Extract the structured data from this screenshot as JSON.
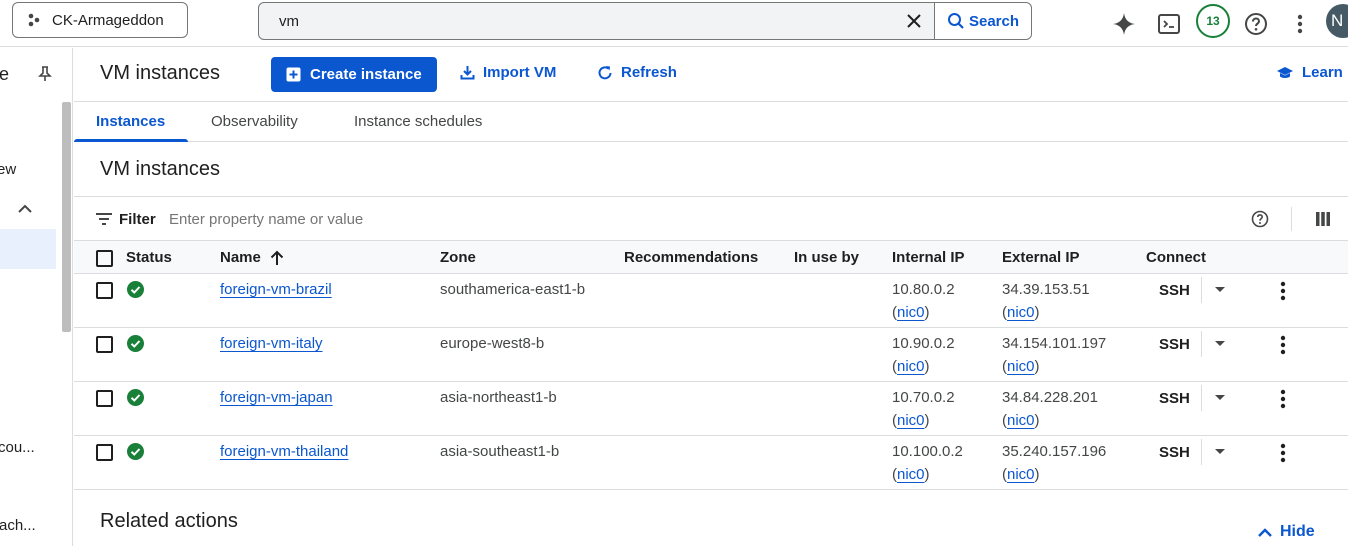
{
  "topbar": {
    "project_name": "CK-Armageddon",
    "search_value": "vm",
    "search_label": "Search",
    "notification_count": "13",
    "avatar_initial": "N"
  },
  "leftnav": {
    "pinned_title_fragment": "e",
    "items": [
      "ew",
      "cou...",
      "ach..."
    ]
  },
  "header": {
    "title": "VM instances",
    "create_label": "Create instance",
    "import_label": "Import VM",
    "refresh_label": "Refresh",
    "learn_label": "Learn"
  },
  "tabs": [
    {
      "label": "Instances",
      "active": true
    },
    {
      "label": "Observability",
      "active": false
    },
    {
      "label": "Instance schedules",
      "active": false
    }
  ],
  "section_title": "VM instances",
  "filter": {
    "label": "Filter",
    "placeholder": "Enter property name or value"
  },
  "table": {
    "columns": [
      "Status",
      "Name",
      "Zone",
      "Recommendations",
      "In use by",
      "Internal IP",
      "External IP",
      "Connect"
    ],
    "sort_column": "Name",
    "rows": [
      {
        "name": "foreign-vm-brazil",
        "zone": "southamerica-east1-b",
        "internal_ip": "10.80.0.2",
        "external_ip": "34.39.153.51",
        "nic": "nic0",
        "connect": "SSH",
        "status": "running"
      },
      {
        "name": "foreign-vm-italy",
        "zone": "europe-west8-b",
        "internal_ip": "10.90.0.2",
        "external_ip": "34.154.101.197",
        "nic": "nic0",
        "connect": "SSH",
        "status": "running"
      },
      {
        "name": "foreign-vm-japan",
        "zone": "asia-northeast1-b",
        "internal_ip": "10.70.0.2",
        "external_ip": "34.84.228.201",
        "nic": "nic0",
        "connect": "SSH",
        "status": "running"
      },
      {
        "name": "foreign-vm-thailand",
        "zone": "asia-southeast1-b",
        "internal_ip": "10.100.0.2",
        "external_ip": "35.240.157.196",
        "nic": "nic0",
        "connect": "SSH",
        "status": "running"
      }
    ]
  },
  "related": {
    "title": "Related actions",
    "hide_label": "Hide"
  },
  "colors": {
    "accent": "#0b57d0",
    "status_ok": "#188038"
  }
}
